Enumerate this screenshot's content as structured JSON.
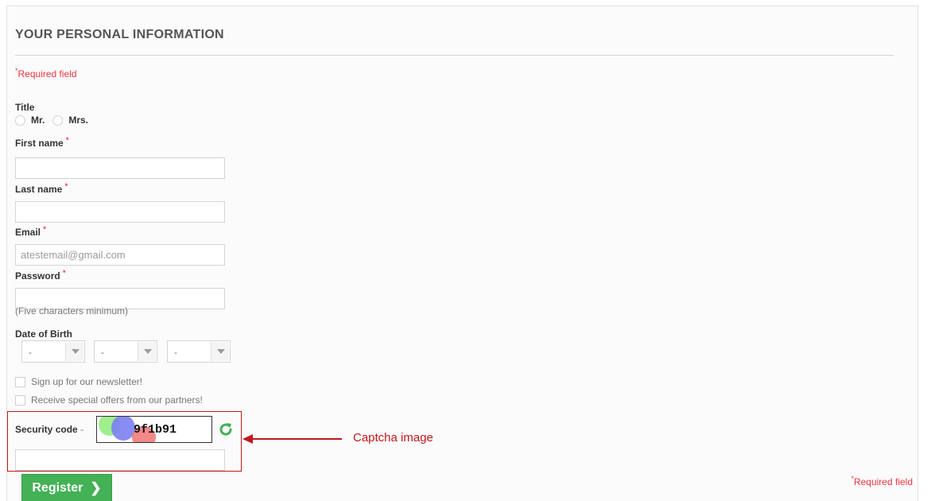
{
  "heading": "YOUR PERSONAL INFORMATION",
  "required_note": "Required field",
  "required_star": "*",
  "title_label": "Title",
  "title_options": [
    "Mr.",
    "Mrs."
  ],
  "first_name": {
    "label": "First name",
    "value": ""
  },
  "last_name": {
    "label": "Last name",
    "value": ""
  },
  "email": {
    "label": "Email",
    "placeholder": "atestemail@gmail.com"
  },
  "password": {
    "label": "Password",
    "hint": "(Five characters minimum)"
  },
  "dob": {
    "label": "Date of Birth",
    "day": "-",
    "month": "-",
    "year": "-"
  },
  "newsletter_label": "Sign up for our newsletter!",
  "offers_label": "Receive special offers from our partners!",
  "captcha": {
    "label": "Security code",
    "separator": "-",
    "code": "9f1b91"
  },
  "annotation": {
    "text": "Captcha image",
    "color": "#c0191c"
  },
  "register_label": "Register",
  "colors": {
    "accent": "#43b155",
    "required": "#f13340"
  }
}
